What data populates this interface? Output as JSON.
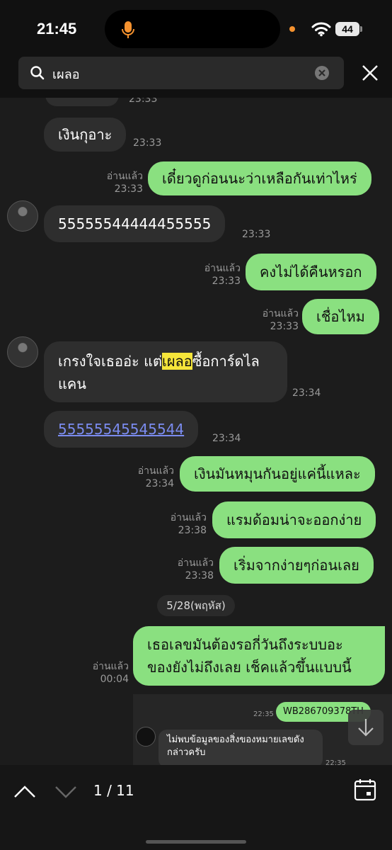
{
  "status_bar": {
    "time": "21:45",
    "battery": "44"
  },
  "search": {
    "query": "เผลอ"
  },
  "chat": {
    "top_partial_time": "23:33",
    "messages": [
      {
        "side": "in",
        "text": "เงินกุอาะ",
        "time": "23:33"
      },
      {
        "side": "out",
        "text": "เดี๋ยวดูก่อนนะว่าเหลือกันเท่าไหร่",
        "read": "อ่านแล้ว",
        "time": "23:33"
      },
      {
        "side": "in",
        "text": "55555544444455555",
        "time": "23:33"
      },
      {
        "side": "out",
        "text": "คงไม่ได้คืนหรอก",
        "read": "อ่านแล้ว",
        "time": "23:33"
      },
      {
        "side": "out",
        "text": "เชื่อไหม",
        "read": "อ่านแล้ว",
        "time": "23:33"
      },
      {
        "side": "in",
        "text_before": "เกรงใจเธออ่ะ แต่",
        "highlight": "เผลอ",
        "text_after": "ซื้อการ์ดไล",
        "line2": "แคน",
        "time": "23:34"
      },
      {
        "side": "in",
        "text": "55555545545544",
        "time": "23:34"
      },
      {
        "side": "out",
        "text": "เงินมันหมุนกันอยู่แค่นี้แหละ",
        "read": "อ่านแล้ว",
        "time": "23:34"
      },
      {
        "side": "out",
        "text": "แรมด้อมน่าจะออกง่าย",
        "read": "อ่านแล้ว",
        "time": "23:38"
      },
      {
        "side": "out",
        "text": "เริ่มจากง่ายๆก่อนเลย",
        "read": "อ่านแล้ว",
        "time": "23:38"
      },
      {
        "side": "out",
        "line1": "เธอเลขมันต้องรอกี่วันถึงระบบอะ",
        "line2": "ของยังไม่ถึงเลย เช็คแล้วขึ้นแบบนี้",
        "read": "อ่านแล้ว",
        "time": "00:04"
      }
    ],
    "date_divider": "5/28(พฤหัส)",
    "embedded": {
      "tracking": "WB286709378TH",
      "time1": "22:35",
      "reply_line1": "ไม่พบข้อมูลของสิ่งของหมายเลขดัง",
      "reply_line2": "กล่าวครับ",
      "time2": "22:35"
    }
  },
  "bottom_bar": {
    "counter": "1 / 11"
  }
}
